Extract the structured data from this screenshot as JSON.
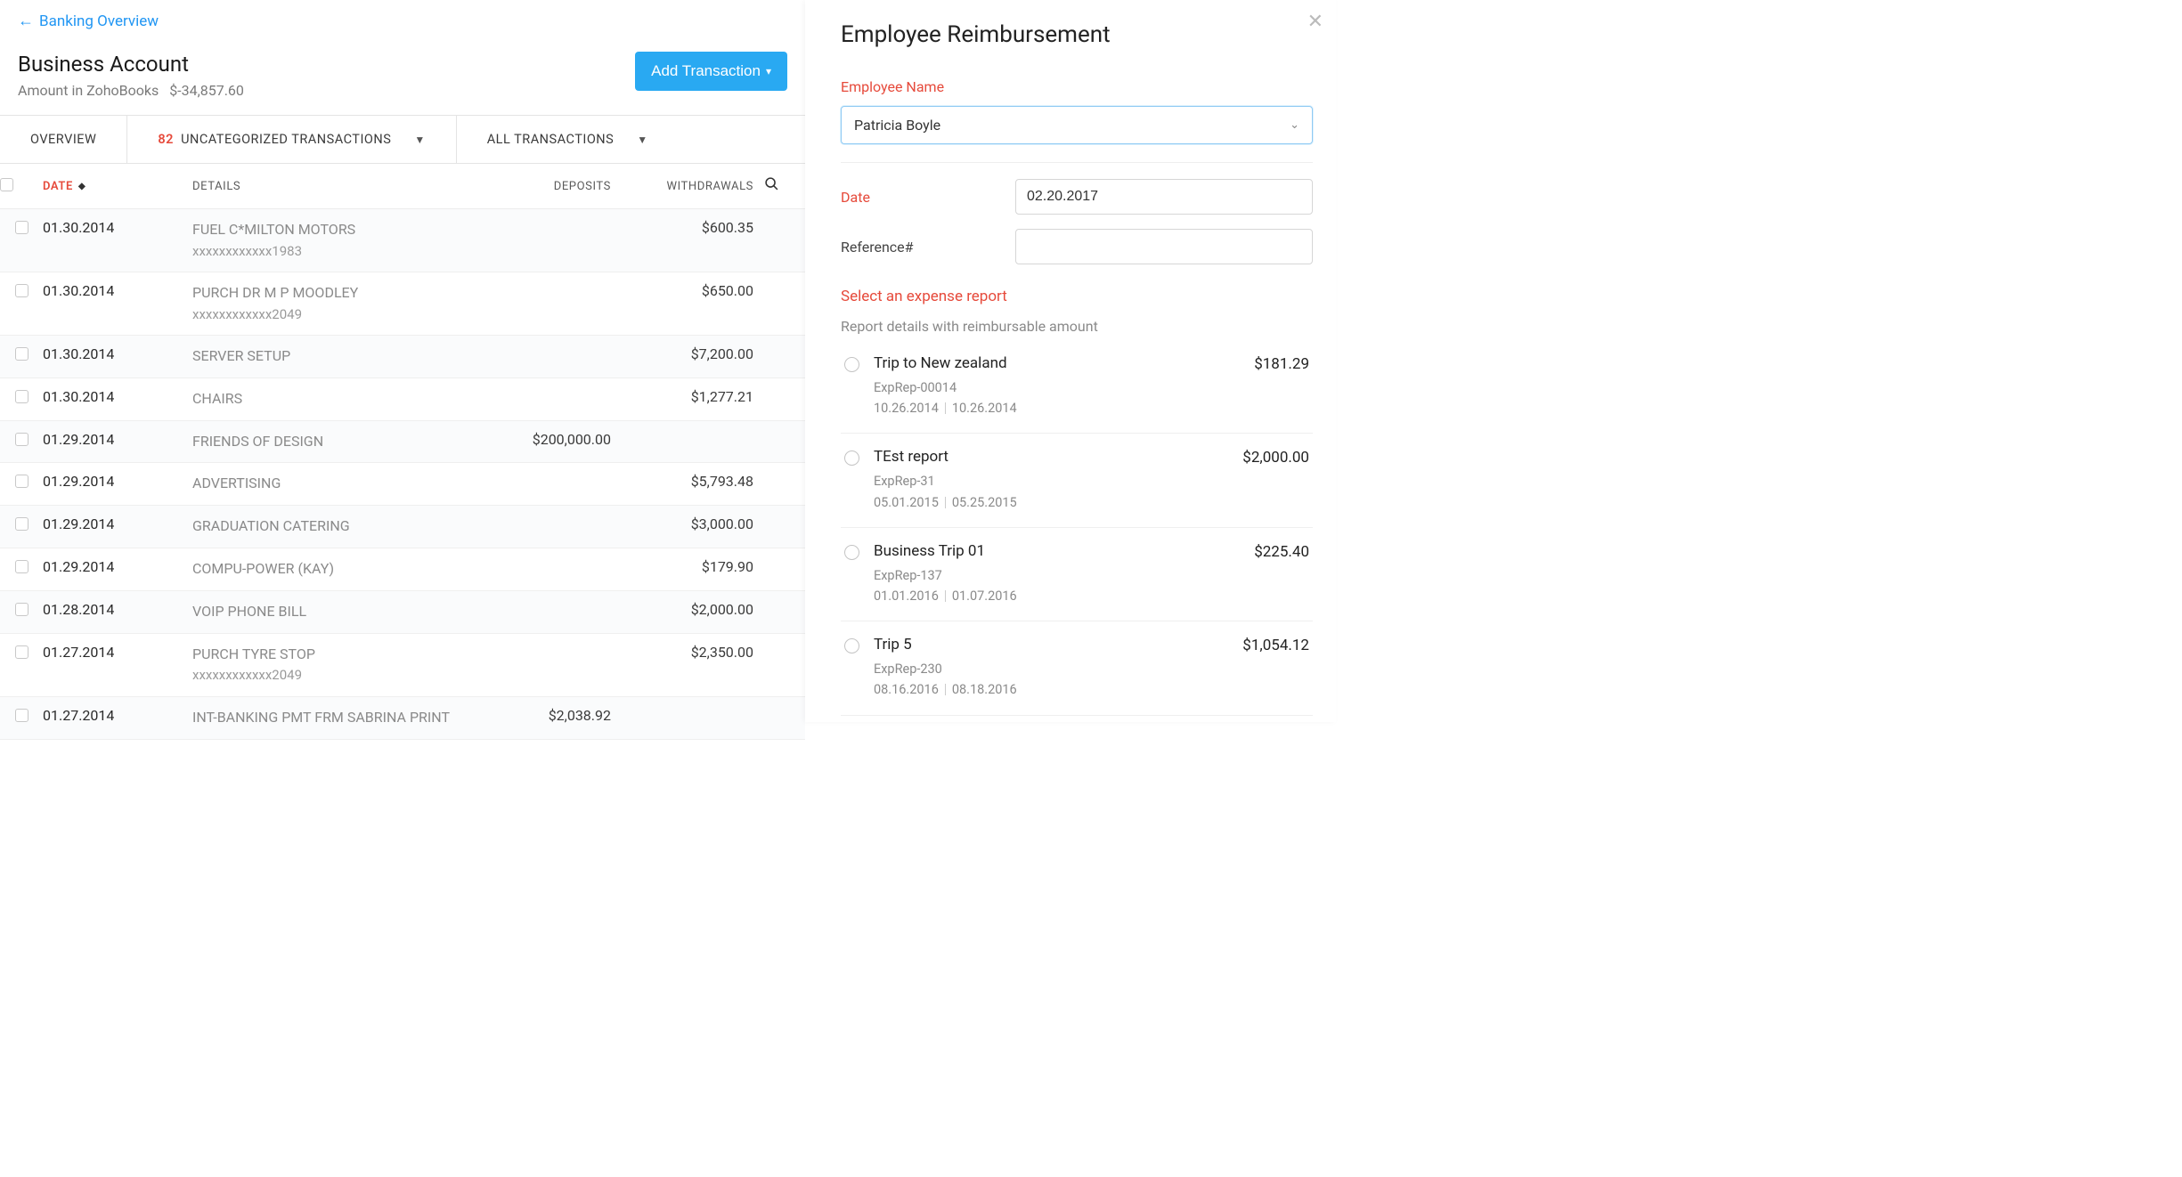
{
  "breadcrumb": {
    "label": "Banking Overview"
  },
  "account": {
    "title": "Business Account",
    "balance_label": "Amount in ZohoBooks",
    "balance_value": "$-34,857.60"
  },
  "buttons": {
    "add_transaction": "Add Transaction"
  },
  "tabs": {
    "overview": "OVERVIEW",
    "uncategorized_count": "82",
    "uncategorized_label": "UNCATEGORIZED TRANSACTIONS",
    "all": "ALL TRANSACTIONS"
  },
  "table": {
    "headers": {
      "date": "DATE",
      "details": "DETAILS",
      "deposits": "DEPOSITS",
      "withdrawals": "WITHDRAWALS"
    },
    "rows": [
      {
        "date": "01.30.2014",
        "details": "FUEL C*MILTON MOTORS",
        "sub": "xxxxxxxxxxxx1983",
        "deposits": "",
        "withdrawals": "$600.35"
      },
      {
        "date": "01.30.2014",
        "details": "PURCH DR M P MOODLEY",
        "sub": "xxxxxxxxxxxx2049",
        "deposits": "",
        "withdrawals": "$650.00"
      },
      {
        "date": "01.30.2014",
        "details": "SERVER SETUP",
        "sub": "",
        "deposits": "",
        "withdrawals": "$7,200.00"
      },
      {
        "date": "01.30.2014",
        "details": "CHAIRS",
        "sub": "",
        "deposits": "",
        "withdrawals": "$1,277.21"
      },
      {
        "date": "01.29.2014",
        "details": "FRIENDS OF DESIGN",
        "sub": "",
        "deposits": "$200,000.00",
        "withdrawals": ""
      },
      {
        "date": "01.29.2014",
        "details": "ADVERTISING",
        "sub": "",
        "deposits": "",
        "withdrawals": "$5,793.48"
      },
      {
        "date": "01.29.2014",
        "details": "GRADUATION CATERING",
        "sub": "",
        "deposits": "",
        "withdrawals": "$3,000.00"
      },
      {
        "date": "01.29.2014",
        "details": "COMPU-POWER (KAY)",
        "sub": "",
        "deposits": "",
        "withdrawals": "$179.90"
      },
      {
        "date": "01.28.2014",
        "details": "VOIP PHONE BILL",
        "sub": "",
        "deposits": "",
        "withdrawals": "$2,000.00"
      },
      {
        "date": "01.27.2014",
        "details": "PURCH TYRE STOP",
        "sub": "xxxxxxxxxxxx2049",
        "deposits": "",
        "withdrawals": "$2,350.00"
      },
      {
        "date": "01.27.2014",
        "details": "INT-BANKING PMT FRM SABRINA PRINT",
        "sub": "",
        "deposits": "$2,038.92",
        "withdrawals": ""
      }
    ]
  },
  "panel": {
    "title": "Employee Reimbursement",
    "employee_label": "Employee Name",
    "employee_value": "Patricia Boyle",
    "date_label": "Date",
    "date_value": "02.20.2017",
    "reference_label": "Reference#",
    "reference_value": "",
    "select_report_label": "Select an expense report",
    "report_details_label": "Report details with reimbursable amount",
    "reports": [
      {
        "title": "Trip to New zealand",
        "id": "ExpRep-00014",
        "from": "10.26.2014",
        "to": "10.26.2014",
        "amount": "$181.29"
      },
      {
        "title": "TEst report",
        "id": "ExpRep-31",
        "from": "05.01.2015",
        "to": "05.25.2015",
        "amount": "$2,000.00"
      },
      {
        "title": "Business Trip 01",
        "id": "ExpRep-137",
        "from": "01.01.2016",
        "to": "01.07.2016",
        "amount": "$225.40"
      },
      {
        "title": "Trip 5",
        "id": "ExpRep-230",
        "from": "08.16.2016",
        "to": "08.18.2016",
        "amount": "$1,054.12"
      }
    ]
  }
}
